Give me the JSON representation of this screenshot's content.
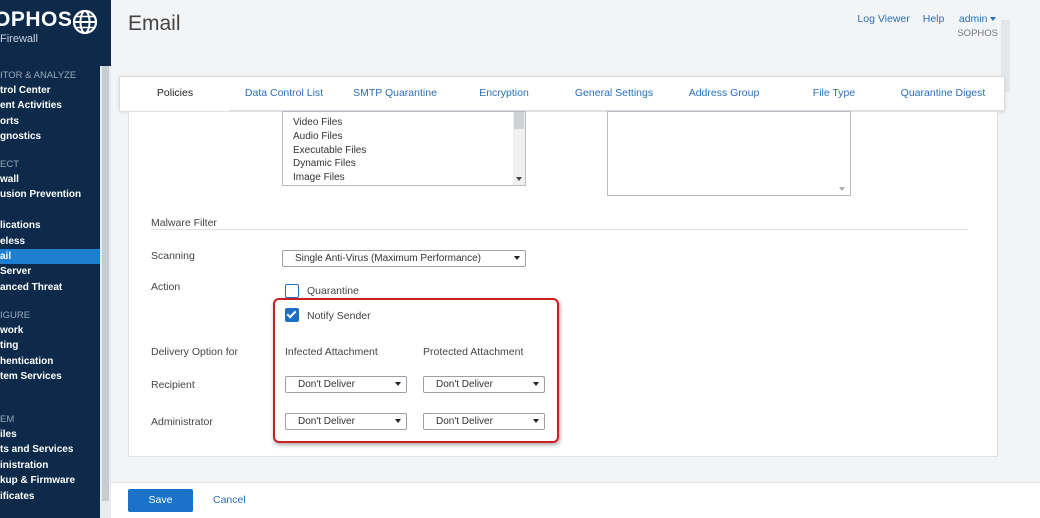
{
  "brand": {
    "logo": "OPHOS",
    "product": "Firewall"
  },
  "sidebar": {
    "groups": [
      {
        "section": "ITOR & ANALYZE",
        "items": [
          {
            "label": "trol Center"
          },
          {
            "label": "ent Activities"
          },
          {
            "label": "orts"
          },
          {
            "label": "gnostics"
          }
        ]
      },
      {
        "section": "ECT",
        "items": [
          {
            "label": "wall"
          },
          {
            "label": "usion Prevention"
          },
          {
            "label": ""
          },
          {
            "label": "lications"
          },
          {
            "label": "eless"
          },
          {
            "label": "ail"
          },
          {
            "label": "Server"
          },
          {
            "label": "anced Threat"
          }
        ]
      },
      {
        "section": "IGURE",
        "items": [
          {
            "label": "work"
          },
          {
            "label": "ting"
          },
          {
            "label": "hentication"
          },
          {
            "label": "tem Services"
          }
        ]
      },
      {
        "section": "EM",
        "items": [
          {
            "label": "iles"
          },
          {
            "label": "ts and Services"
          },
          {
            "label": "inistration"
          },
          {
            "label": "kup & Firmware"
          },
          {
            "label": "ificates"
          }
        ]
      }
    ]
  },
  "header": {
    "title": "Email",
    "links": {
      "log_viewer": "Log Viewer",
      "help": "Help",
      "admin": "admin",
      "org": "SOPHOS"
    }
  },
  "tabs": [
    {
      "label": "Policies",
      "active": true
    },
    {
      "label": "Data Control List"
    },
    {
      "label": "SMTP Quarantine"
    },
    {
      "label": "Encryption"
    },
    {
      "label": "General Settings"
    },
    {
      "label": "Address Group"
    },
    {
      "label": "File Type"
    },
    {
      "label": "Quarantine Digest"
    }
  ],
  "file_types": [
    "Video Files",
    "Audio Files",
    "Executable Files",
    "Dynamic Files",
    "Image Files"
  ],
  "malware_filter": {
    "heading": "Malware Filter",
    "scanning_label": "Scanning",
    "scanning_value": "Single Anti-Virus (Maximum Performance)",
    "action_label": "Action",
    "quarantine_label": "Quarantine",
    "quarantine_checked": false,
    "notify_label": "Notify Sender",
    "notify_checked": true,
    "delivery_label": "Delivery Option for",
    "col_infected": "Infected Attachment",
    "col_protected": "Protected Attachment",
    "recipient_label": "Recipient",
    "recipient_infected": "Don't Deliver",
    "recipient_protected": "Don't Deliver",
    "administrator_label": "Administrator",
    "admin_infected": "Don't Deliver",
    "admin_protected": "Don't Deliver"
  },
  "footer": {
    "save": "Save",
    "cancel": "Cancel"
  },
  "colors": {
    "sidebar_bg": "#0d2a4a",
    "accent": "#1a73c9",
    "highlight": "#cc1f24"
  }
}
